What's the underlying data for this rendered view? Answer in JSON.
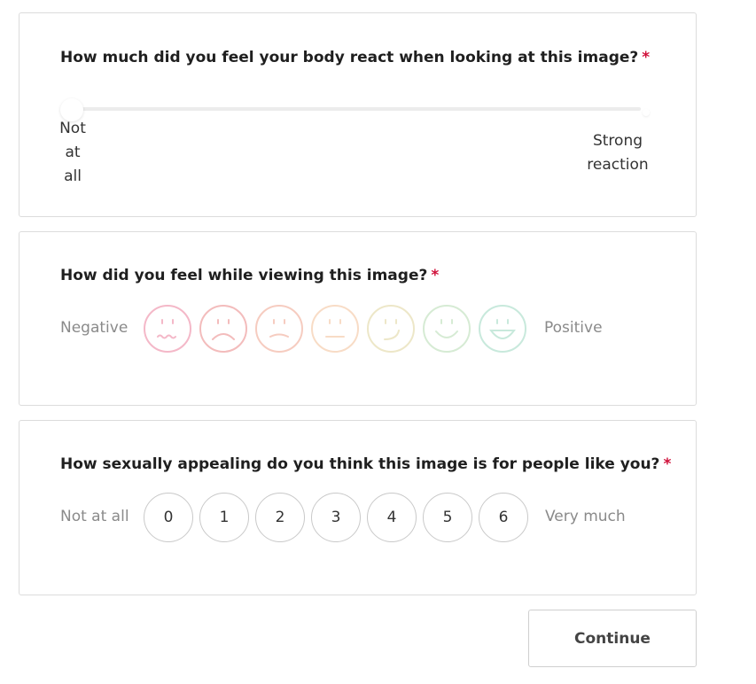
{
  "questions": {
    "q1": {
      "title": "How much did you feel your body react when looking at this image?",
      "required_mark": "*",
      "slider": {
        "value_fraction": 0,
        "min_label_lines": [
          "Not",
          "at",
          "all"
        ],
        "max_label_lines": [
          "Strong",
          "reaction"
        ]
      }
    },
    "q2": {
      "title": "How did you feel while viewing this image?",
      "required_mark": "*",
      "left_label": "Negative",
      "right_label": "Positive",
      "faces": [
        {
          "name": "wavy-mouth-face-icon",
          "color": "#f4b8c8"
        },
        {
          "name": "sad-face-icon",
          "color": "#f3bcbc"
        },
        {
          "name": "slightly-sad-face-icon",
          "color": "#f6ccc0"
        },
        {
          "name": "neutral-face-icon",
          "color": "#f8dcc6"
        },
        {
          "name": "slight-smile-face-icon",
          "color": "#ede7c8"
        },
        {
          "name": "smile-face-icon",
          "color": "#d6ebd4"
        },
        {
          "name": "big-smile-face-icon",
          "color": "#c8e9dc"
        }
      ]
    },
    "q3": {
      "title": "How sexually appealing do you think this image is for people like you?",
      "required_mark": "*",
      "left_label": "Not at all",
      "right_label": "Very much",
      "options": [
        "0",
        "1",
        "2",
        "3",
        "4",
        "5",
        "6"
      ]
    }
  },
  "continue_label": "Continue"
}
